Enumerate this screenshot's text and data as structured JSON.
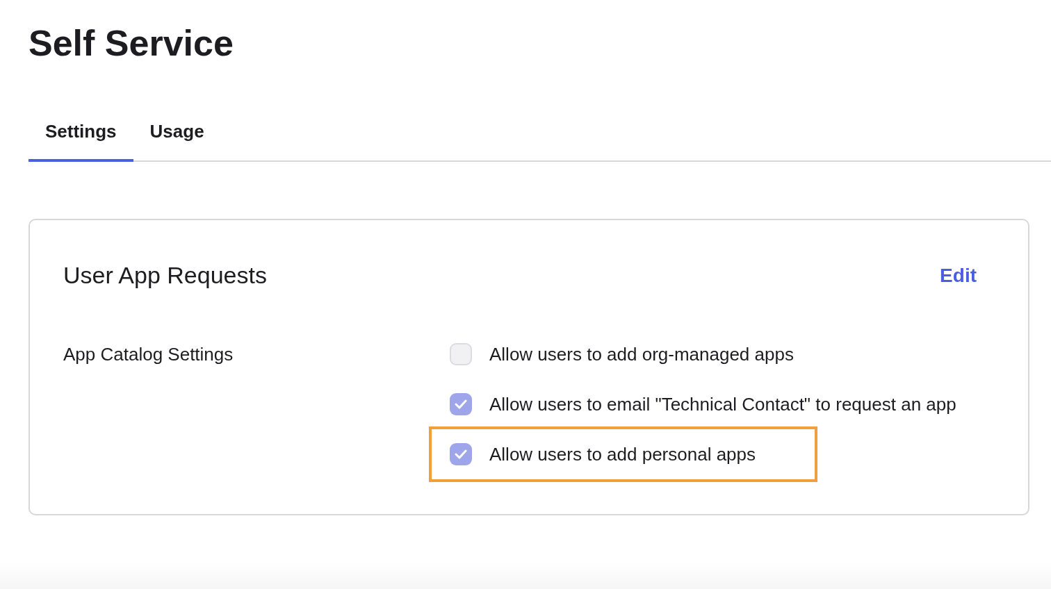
{
  "page": {
    "title": "Self Service"
  },
  "tabs": [
    {
      "label": "Settings",
      "selected": true
    },
    {
      "label": "Usage",
      "selected": false
    }
  ],
  "card": {
    "title": "User App Requests",
    "edit_link": "Edit",
    "setting_label": "App Catalog Settings",
    "options": [
      {
        "label": "Allow users to add org-managed apps",
        "checked": false,
        "highlighted": false
      },
      {
        "label": "Allow users to email \"Technical Contact\" to request an app",
        "checked": true,
        "highlighted": false
      },
      {
        "label": "Allow users to add personal apps",
        "checked": true,
        "highlighted": true
      }
    ]
  }
}
